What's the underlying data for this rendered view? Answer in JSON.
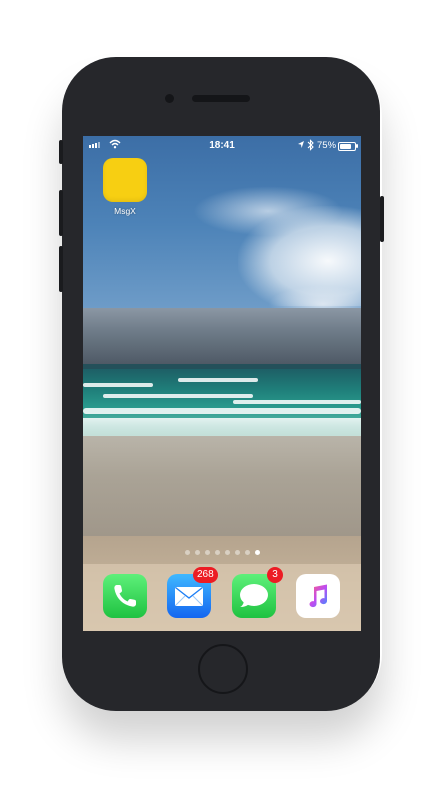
{
  "status_bar": {
    "time": "18:41",
    "battery_percent": "75%",
    "battery_level": 0.75,
    "icons": [
      "signal-icon",
      "wifi-icon",
      "location-icon",
      "bluetooth-icon",
      "battery-icon"
    ]
  },
  "home_screen": {
    "apps": [
      {
        "label": "MsgX",
        "icon": "msgx-icon",
        "color": "#f7cf12"
      }
    ],
    "page_count": 8,
    "active_page": 8
  },
  "dock": {
    "apps": [
      {
        "name": "Phone",
        "icon": "phone-icon",
        "color": "#2fd158",
        "badge": ""
      },
      {
        "name": "Mail",
        "icon": "mail-icon",
        "color": "#1a8cff",
        "badge": "268"
      },
      {
        "name": "Messages",
        "icon": "messages-icon",
        "color": "#2fd158",
        "badge": "3"
      },
      {
        "name": "Music",
        "icon": "music-icon",
        "color": "#ffffff",
        "badge": ""
      }
    ]
  }
}
